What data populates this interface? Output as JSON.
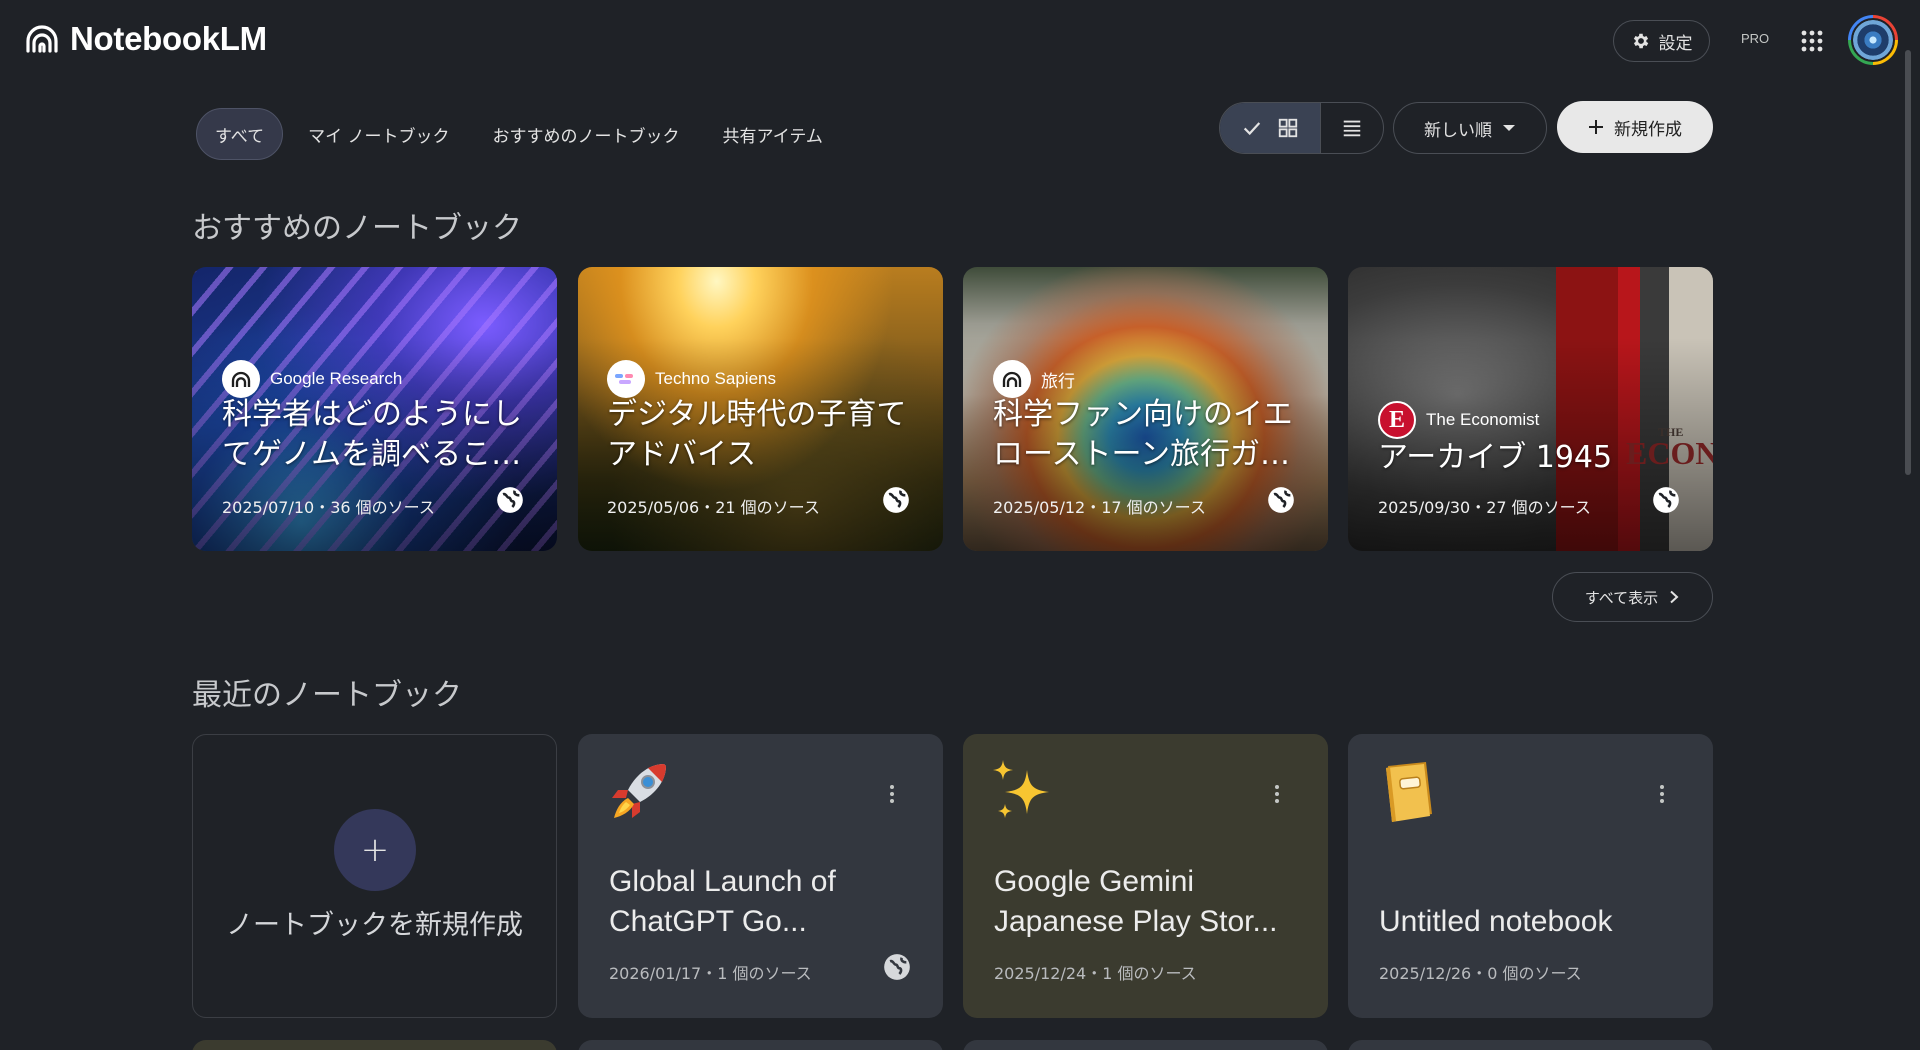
{
  "app": {
    "name": "NotebookLM"
  },
  "header": {
    "settings_label": "設定",
    "pro_badge": "PRO"
  },
  "filters": {
    "tabs": [
      {
        "label": "すべて",
        "active": true
      },
      {
        "label": "マイ ノートブック",
        "active": false
      },
      {
        "label": "おすすめのノートブック",
        "active": false
      },
      {
        "label": "共有アイテム",
        "active": false
      }
    ],
    "sort_label": "新しい順",
    "create_label": "新規作成"
  },
  "featured": {
    "title": "おすすめのノートブック",
    "show_all": "すべて表示",
    "cards": [
      {
        "source": "Google Research",
        "title_lines": [
          "科学者はどのようにし",
          "てゲノムを調べるこ…"
        ],
        "meta": "2025/07/10・36 個のソース"
      },
      {
        "source": "Techno Sapiens",
        "title_lines": [
          "デジタル時代の子育て",
          "アドバイス"
        ],
        "meta": "2025/05/06・21 個のソース"
      },
      {
        "source": "旅行",
        "title_lines": [
          "科学ファン向けのイエ",
          "ローストーン旅行ガ…"
        ],
        "meta": "2025/05/12・17 個のソース"
      },
      {
        "source": "The Economist",
        "title_lines": [
          "アーカイブ 1945"
        ],
        "meta": "2025/09/30・27 個のソース",
        "logo_letter": "E",
        "art_text_top": "THE",
        "art_text": "ECONON"
      }
    ]
  },
  "recent": {
    "title": "最近のノートブック",
    "new_label": "ノートブックを新規作成",
    "new_plus": "+",
    "cards": [
      {
        "emoji": "rocket-icon",
        "title_lines": [
          "Global Launch of",
          "ChatGPT Go..."
        ],
        "meta": "2026/01/17・1 個のソース"
      },
      {
        "emoji": "sparkles-icon",
        "title_lines": [
          "Google Gemini",
          "Japanese Play Stor..."
        ],
        "meta": "2025/12/24・1 個のソース"
      },
      {
        "emoji": "notebook-icon",
        "title_lines": [
          "Untitled notebook"
        ],
        "meta": "2025/12/26・0 個のソース"
      }
    ]
  },
  "colors": {
    "background": "#1f2227",
    "card_blue": "#33373f",
    "card_olive": "#3b3b2f",
    "accent_circle": "#34385a"
  }
}
